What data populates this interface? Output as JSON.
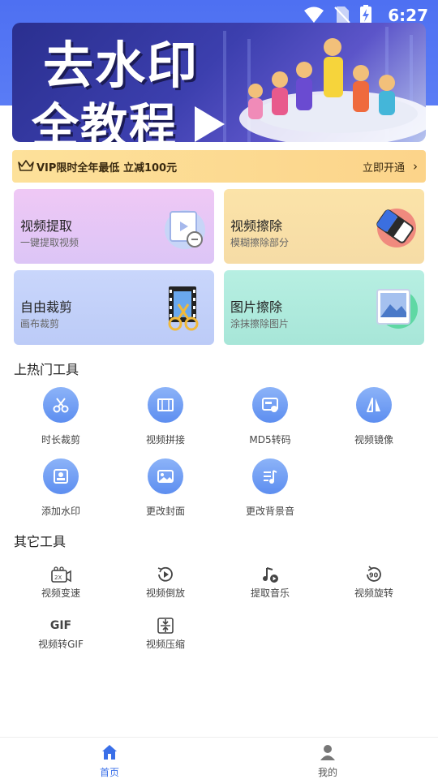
{
  "status_bar": {
    "time": "6:27"
  },
  "banner": {
    "line1": "去水印",
    "line2": "全教程"
  },
  "vip": {
    "text": "VIP限时全年最低 立减100元",
    "cta": "立即开通"
  },
  "cards": [
    {
      "title": "视频提取",
      "subtitle": "一键提取视频",
      "icon": "video-link-icon"
    },
    {
      "title": "视频擦除",
      "subtitle": "模糊擦除部分",
      "icon": "eraser-icon"
    },
    {
      "title": "自由裁剪",
      "subtitle": "画布裁剪",
      "icon": "film-scissors-icon"
    },
    {
      "title": "图片擦除",
      "subtitle": "涂抹擦除图片",
      "icon": "image-icon"
    }
  ],
  "hot_tools": {
    "title": "上热门工具",
    "items": [
      {
        "label": "时长裁剪",
        "icon": "scissors-icon"
      },
      {
        "label": "视频拼接",
        "icon": "film-icon"
      },
      {
        "label": "MD5转码",
        "icon": "md5-icon"
      },
      {
        "label": "视频镜像",
        "icon": "mirror-icon"
      },
      {
        "label": "添加水印",
        "icon": "watermark-icon"
      },
      {
        "label": "更改封面",
        "icon": "picture-icon"
      },
      {
        "label": "更改背景音",
        "icon": "music-list-icon"
      }
    ]
  },
  "other_tools": {
    "title": "其它工具",
    "items": [
      {
        "label": "视频变速",
        "icon": "speed-camera-icon",
        "glyph": "2X"
      },
      {
        "label": "视频倒放",
        "icon": "reverse-play-icon",
        "glyph": ""
      },
      {
        "label": "提取音乐",
        "icon": "music-note-icon",
        "glyph": ""
      },
      {
        "label": "视频旋转",
        "icon": "rotate-90-icon",
        "glyph": "90"
      },
      {
        "label": "视频转GIF",
        "icon": "gif-icon",
        "glyph": "GIF"
      },
      {
        "label": "视频压缩",
        "icon": "compress-icon",
        "glyph": ""
      }
    ]
  },
  "tabbar": {
    "items": [
      {
        "label": "首页",
        "icon": "home-icon",
        "active": true
      },
      {
        "label": "我的",
        "icon": "user-icon",
        "active": false
      }
    ],
    "active_color": "#3a6fe8",
    "inactive_color": "#555555"
  },
  "colors": {
    "accent": "#4e70f2",
    "vip_bg": "#fcd48a"
  }
}
